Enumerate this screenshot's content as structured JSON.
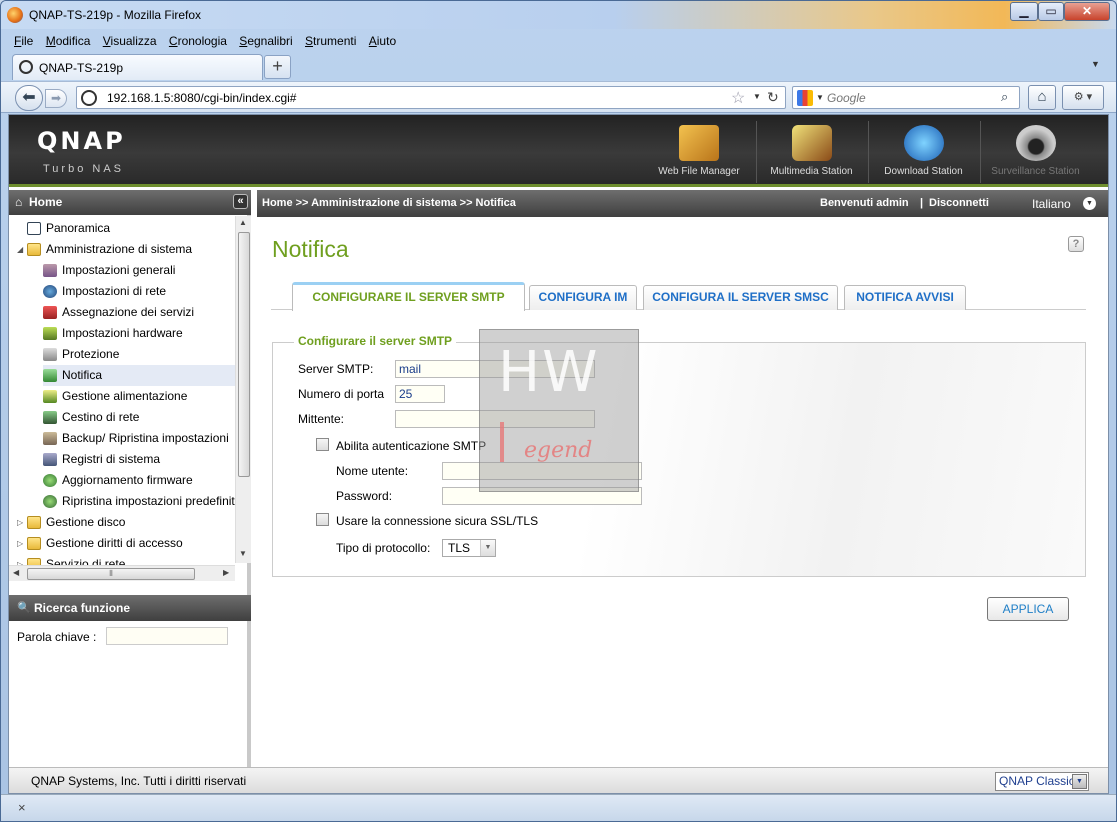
{
  "window": {
    "title": "QNAP-TS-219p - Mozilla Firefox"
  },
  "menu": [
    "File",
    "Modifica",
    "Visualizza",
    "Cronologia",
    "Segnalibri",
    "Strumenti",
    "Aiuto"
  ],
  "browser_tab": {
    "label": "QNAP-TS-219p",
    "new_tab": "+"
  },
  "nav": {
    "url": "192.168.1.5:8080/cgi-bin/index.cgi#",
    "search_placeholder": "Google"
  },
  "qnap": {
    "logo": "QNAP",
    "sub": "Turbo NAS"
  },
  "apps": [
    "Web File Manager",
    "Multimedia Station",
    "Download Station",
    "Surveillance Station"
  ],
  "left": {
    "home": "Home",
    "tree": [
      "Panoramica",
      "Amministrazione di sistema",
      "Impostazioni generali",
      "Impostazioni di rete",
      "Assegnazione dei servizi",
      "Impostazioni hardware",
      "Protezione",
      "Notifica",
      "Gestione alimentazione",
      "Cestino di rete",
      "Backup/ Ripristina impostazioni",
      "Registri di sistema",
      "Aggiornamento firmware",
      "Ripristina impostazioni predefinite",
      "Gestione disco",
      "Gestione diritti di accesso",
      "Servizio di rete"
    ],
    "search_title": "Ricerca funzione",
    "keyword_label": "Parola chiave :"
  },
  "topbar": {
    "breadcrumb": "Home >> Amministrazione di sistema >> Notifica",
    "welcome": "Benvenuti admin",
    "sep": "|",
    "logout": "Disconnetti",
    "language": "Italiano"
  },
  "page": {
    "title": "Notifica",
    "tabs": [
      "CONFIGURARE IL SERVER SMTP",
      "CONFIGURA IM",
      "CONFIGURA IL SERVER SMSC",
      "NOTIFICA AVVISI"
    ],
    "legend": "Configurare il server SMTP",
    "server_label": "Server SMTP:",
    "server_value": "mail",
    "port_label": "Numero di porta",
    "port_value": "25",
    "sender_label": "Mittente:",
    "sender_value": "",
    "auth_label": "Abilita autenticazione SMTP",
    "user_label": "Nome utente:",
    "password_label": "Password:",
    "ssl_label": "Usare la connessione sicura SSL/TLS",
    "protocol_label": "Tipo di protocollo:",
    "protocol_value": "TLS",
    "apply": "APPLICA"
  },
  "watermark": {
    "top": "HW",
    "bottom": "egend"
  },
  "footer": {
    "copyright": "QNAP Systems, Inc. Tutti i diritti riservati",
    "theme": "QNAP Classic"
  },
  "status": {
    "close": "×"
  }
}
